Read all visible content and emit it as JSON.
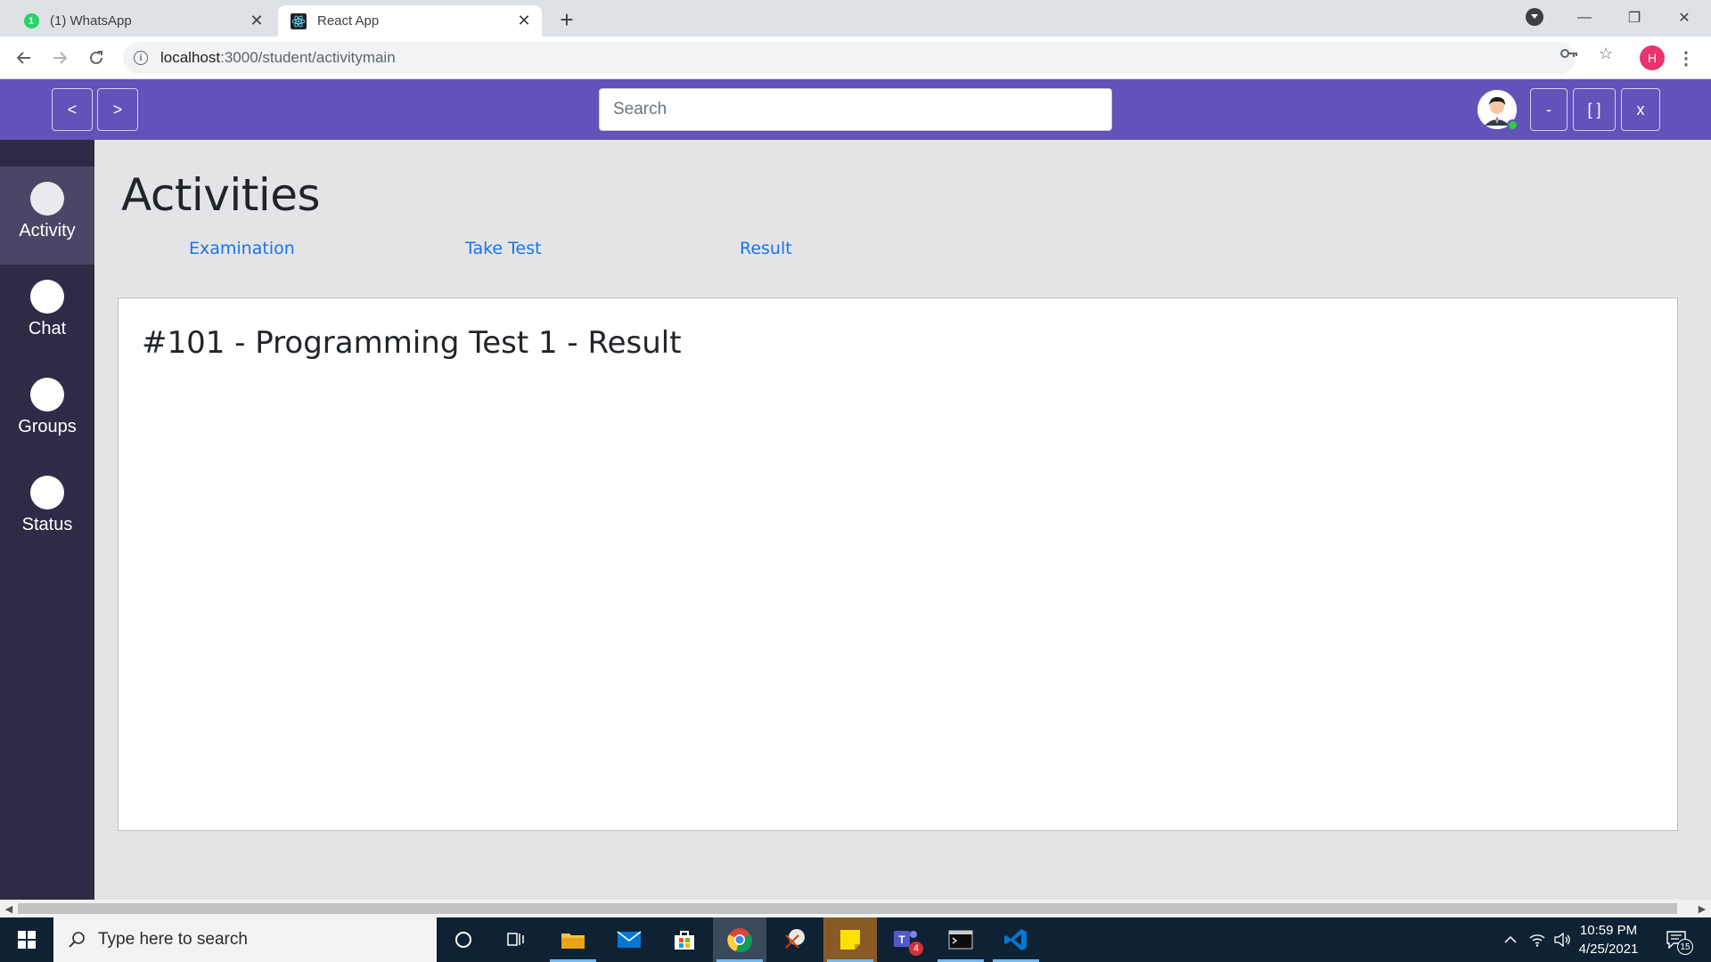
{
  "browser": {
    "tabs": [
      {
        "title": "(1) WhatsApp",
        "badge": "1",
        "active": false
      },
      {
        "title": "React App",
        "active": true
      }
    ],
    "new_tab": "+",
    "window_controls": {
      "minimize": "—",
      "restore": "❐",
      "close": "✕"
    },
    "address": {
      "host": "localhost",
      "path": ":3000/student/activitymain"
    },
    "profile_initial": "H"
  },
  "app_header": {
    "back_label": "<",
    "forward_label": ">",
    "search_placeholder": "Search",
    "window_buttons": {
      "minimize": "-",
      "maximize": "[ ]",
      "close": "x"
    }
  },
  "sidebar": {
    "items": [
      {
        "label": "Activity",
        "active": true
      },
      {
        "label": "Chat",
        "active": false
      },
      {
        "label": "Groups",
        "active": false
      },
      {
        "label": "Status",
        "active": false
      }
    ]
  },
  "main": {
    "title": "Activities",
    "subnav": [
      {
        "label": "Examination"
      },
      {
        "label": "Take Test"
      },
      {
        "label": "Result"
      }
    ],
    "card_title": "#101 - Programming Test 1 - Result"
  },
  "taskbar": {
    "search_placeholder": "Type here to search",
    "time": "10:59 PM",
    "date": "4/25/2021",
    "teams_badge": "4",
    "notification_count": "15"
  },
  "colors": {
    "header": "#6352b9",
    "sidebar": "#2d2b45",
    "sidebar_active": "#4a4766",
    "link": "#1a73e8",
    "taskbar": "#0f2233"
  }
}
